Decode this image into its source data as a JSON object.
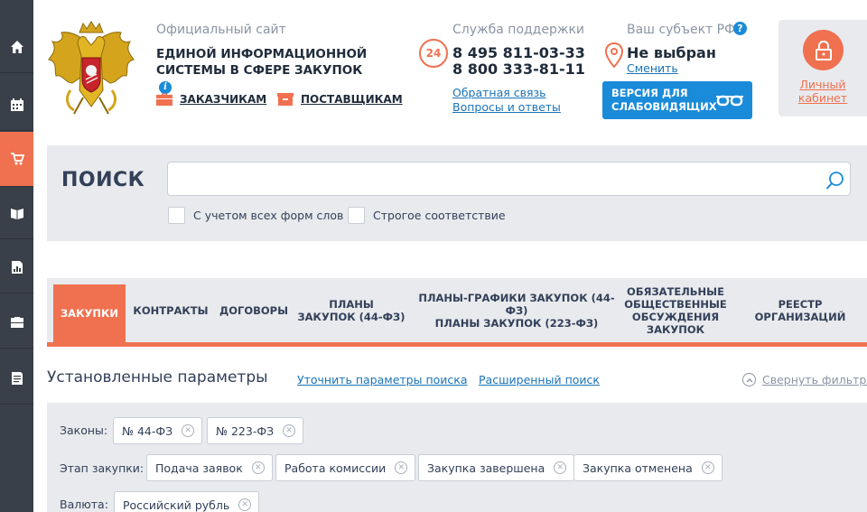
{
  "colors": {
    "accent": "#f0714f",
    "link": "#1a73b8",
    "info": "#1a8bd8",
    "sidebar": "#3a4049",
    "panel": "#e8eaed"
  },
  "sidebar": {
    "items": [
      {
        "icon": "home-icon"
      },
      {
        "icon": "calendar-icon"
      },
      {
        "icon": "cart-icon",
        "active": true
      },
      {
        "icon": "book-icon"
      },
      {
        "icon": "report-icon"
      },
      {
        "icon": "briefcase-icon"
      },
      {
        "icon": "document-icon"
      }
    ]
  },
  "header": {
    "site_label": "Официальный сайт",
    "site_name_line1": "ЕДИНОЙ ИНФОРМАЦИОННОЙ",
    "site_name_line2": "СИСТЕМЫ В СФЕРЕ ЗАКУПОК",
    "customers_link": "ЗАКАЗЧИКАМ",
    "suppliers_link": "ПОСТАВЩИКАМ",
    "support_label": "Служба поддержки",
    "support_badge": "24",
    "phone1": "8 495 811-03-33",
    "phone2": "8 800 333-81-11",
    "feedback_link": "Обратная связь",
    "faq_link": "Вопросы и ответы",
    "region_label": "Ваш субъект РФ",
    "region_value": "Не выбран",
    "region_change": "Сменить",
    "vision_line1": "ВЕРСИЯ ДЛЯ",
    "vision_line2": "СЛАБОВИДЯЩИХ",
    "cabinet_line1": "Личный",
    "cabinet_line2": "кабинет"
  },
  "search": {
    "title": "ПОИСК",
    "value": "",
    "option1": "С учетом всех форм слов",
    "option2": "Строгое соответствие"
  },
  "tabs": {
    "purchases": "ЗАКУПКИ",
    "contracts": "КОНТРАКТЫ",
    "agreements": "ДОГОВОРЫ",
    "plans_l1": "ПЛАНЫ",
    "plans_l2": "ЗАКУПОК (44-ФЗ)",
    "schedules_l1": "ПЛАНЫ-ГРАФИКИ ЗАКУПОК (44-ФЗ)",
    "schedules_l2": "ПЛАНЫ ЗАКУПОК (223-ФЗ)",
    "discussion_l1": "ОБЯЗАТЕЛЬНЫЕ",
    "discussion_l2": "ОБЩЕСТВЕННЫЕ",
    "discussion_l3": "ОБСУЖДЕНИЯ",
    "discussion_l4": "ЗАКУПОК",
    "registry_l1": "РЕЕСТР",
    "registry_l2": "ОРГАНИЗАЦИЙ"
  },
  "params": {
    "title": "Установленные параметры",
    "refine_link": "Уточнить параметры поиска",
    "advanced_link": "Расширенный поиск",
    "collapse_link": "Свернуть фильтры"
  },
  "filters": {
    "laws_label": "Законы:",
    "laws": [
      "№ 44-ФЗ",
      "№ 223-ФЗ"
    ],
    "stage_label": "Этап закупки:",
    "stages": [
      "Подача заявок",
      "Работа комиссии",
      "Закупка завершена",
      "Закупка отменена"
    ],
    "currency_label": "Валюта:",
    "currencies": [
      "Российский рубль"
    ]
  }
}
